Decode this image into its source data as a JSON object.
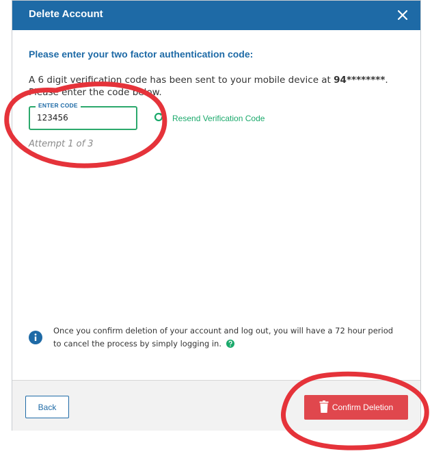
{
  "header": {
    "title": "Delete Account",
    "close_icon": "close-icon"
  },
  "prompt": "Please enter your two factor authentication code:",
  "description": {
    "text": "A 6 digit verification code has been sent to your mobile device at ",
    "phone": "94********",
    "suffix": ".",
    "line2": "Please enter the code below."
  },
  "code_field": {
    "label": "ENTER CODE",
    "value": "123456"
  },
  "resend": {
    "label": "Resend Verification Code",
    "icon": "refresh-icon"
  },
  "attempt": "Attempt 1 of 3",
  "info": {
    "text": "Once you confirm deletion of your account and log out, you will have a 72 hour period to cancel the process by simply logging in.",
    "icon": "info-icon",
    "help_icon": "help-icon"
  },
  "footer": {
    "back_label": "Back",
    "confirm_label": "Confirm Deletion",
    "confirm_icon": "trash-icon"
  },
  "colors": {
    "header": "#1e6aa6",
    "accent_green": "#1aa96b",
    "danger": "#e0474d",
    "annotation_red": "#e5333a"
  }
}
